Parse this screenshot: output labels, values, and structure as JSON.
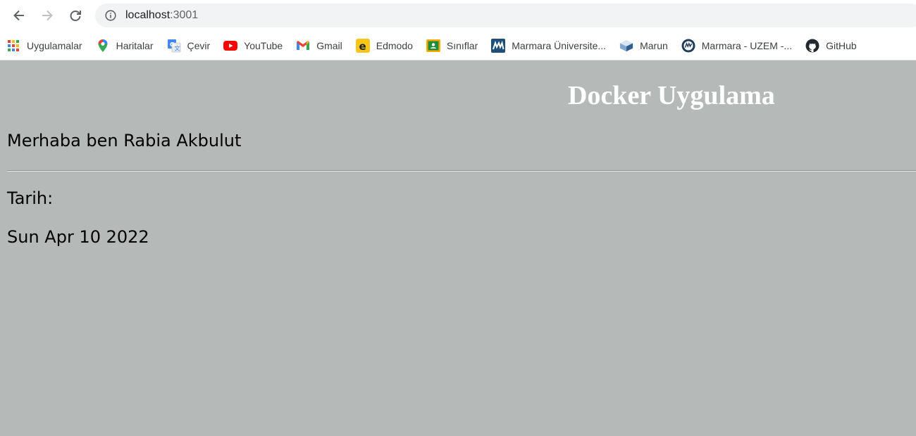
{
  "browser": {
    "url_host": "localhost",
    "url_port": ":3001",
    "bookmarks": [
      {
        "label": "Uygulamalar",
        "icon": "apps-grid-icon"
      },
      {
        "label": "Haritalar",
        "icon": "maps-pin-icon"
      },
      {
        "label": "Çevir",
        "icon": "translate-icon"
      },
      {
        "label": "YouTube",
        "icon": "youtube-icon"
      },
      {
        "label": "Gmail",
        "icon": "gmail-icon"
      },
      {
        "label": "Edmodo",
        "icon": "edmodo-icon"
      },
      {
        "label": "Sınıflar",
        "icon": "classroom-icon"
      },
      {
        "label": "Marmara Üniversite...",
        "icon": "marmara-icon"
      },
      {
        "label": "Marun",
        "icon": "marun-icon"
      },
      {
        "label": "Marmara - UZEM -...",
        "icon": "uzem-icon"
      },
      {
        "label": "GitHub",
        "icon": "github-icon"
      }
    ]
  },
  "page": {
    "heading": "Docker Uygulama",
    "greeting": "Merhaba ben Rabia Akbulut",
    "date_label": "Tarih:",
    "date_value": "Sun Apr 10 2022"
  },
  "colors": {
    "page_background": "#b5bab8",
    "heading_color": "#ffffff",
    "text_color": "#000000"
  }
}
